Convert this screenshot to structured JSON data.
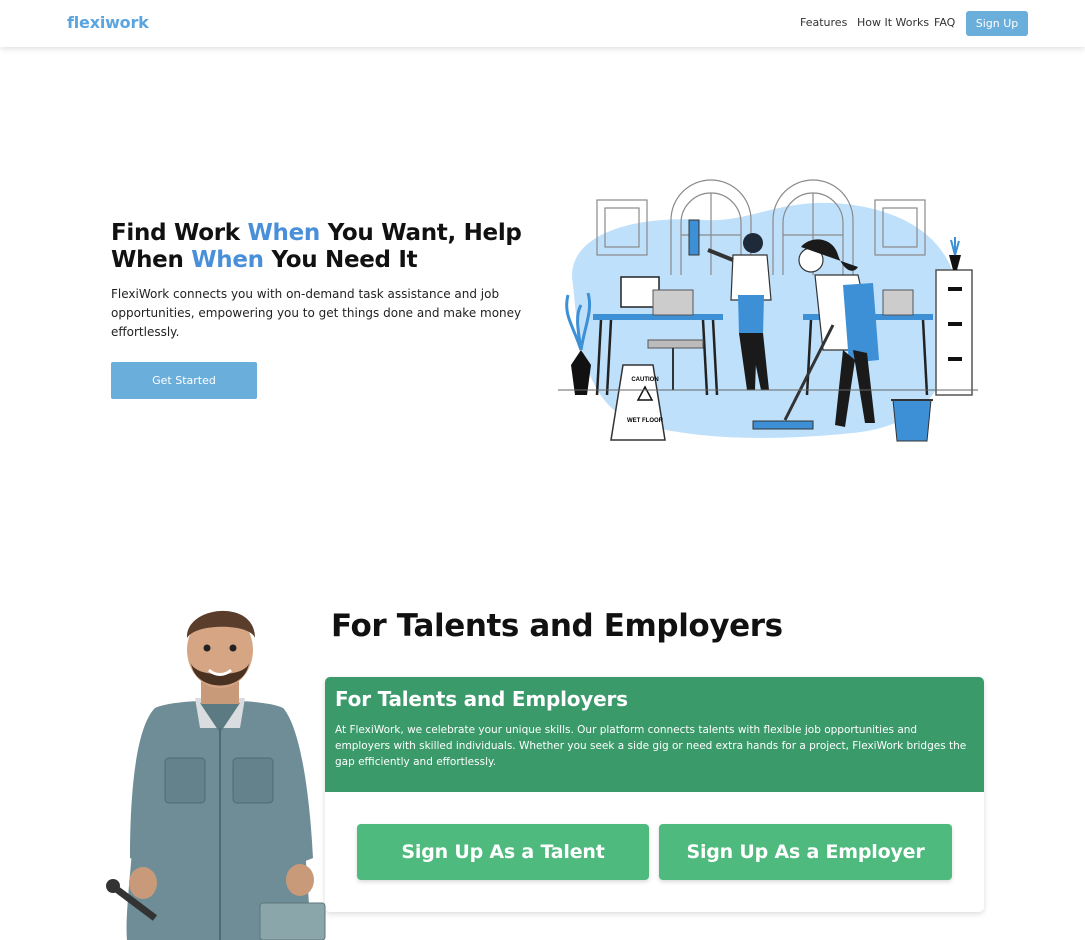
{
  "nav": {
    "brand": "flexiwork",
    "links": [
      "Features",
      "How It Works",
      "FAQ"
    ],
    "signup": "Sign Up"
  },
  "hero": {
    "title_parts": [
      "Find Work ",
      "When",
      " You Want, Help When ",
      "When",
      " You Need It"
    ],
    "description": "FlexiWork connects you with on-demand task assistance and job opportunities, empowering you to get things done and make money effortlessly.",
    "cta": "Get Started",
    "sign_caution": "CAUTION",
    "sign_wet_floor": "WET FLOOR"
  },
  "section": {
    "title": "For Talents and Employers",
    "card_title": "For Talents and Employers",
    "card_text": "At FlexiWork, we celebrate your unique skills. Our platform connects talents with flexible job opportunities and employers with skilled individuals. Whether you seek a side gig or need extra hands for a project, FlexiWork bridges the gap efficiently and effortlessly.",
    "talent_button": "Sign Up As a Talent",
    "employer_button": "Sign Up As a Employer"
  },
  "colors": {
    "brand": "#5aa4e0",
    "highlight": "#4a90d9",
    "button": "#6aaedc",
    "card_header": "#3a9a6a",
    "cta_green": "#4fba7e"
  },
  "icons": [
    "cleaning-illustration",
    "worker-avatar"
  ]
}
